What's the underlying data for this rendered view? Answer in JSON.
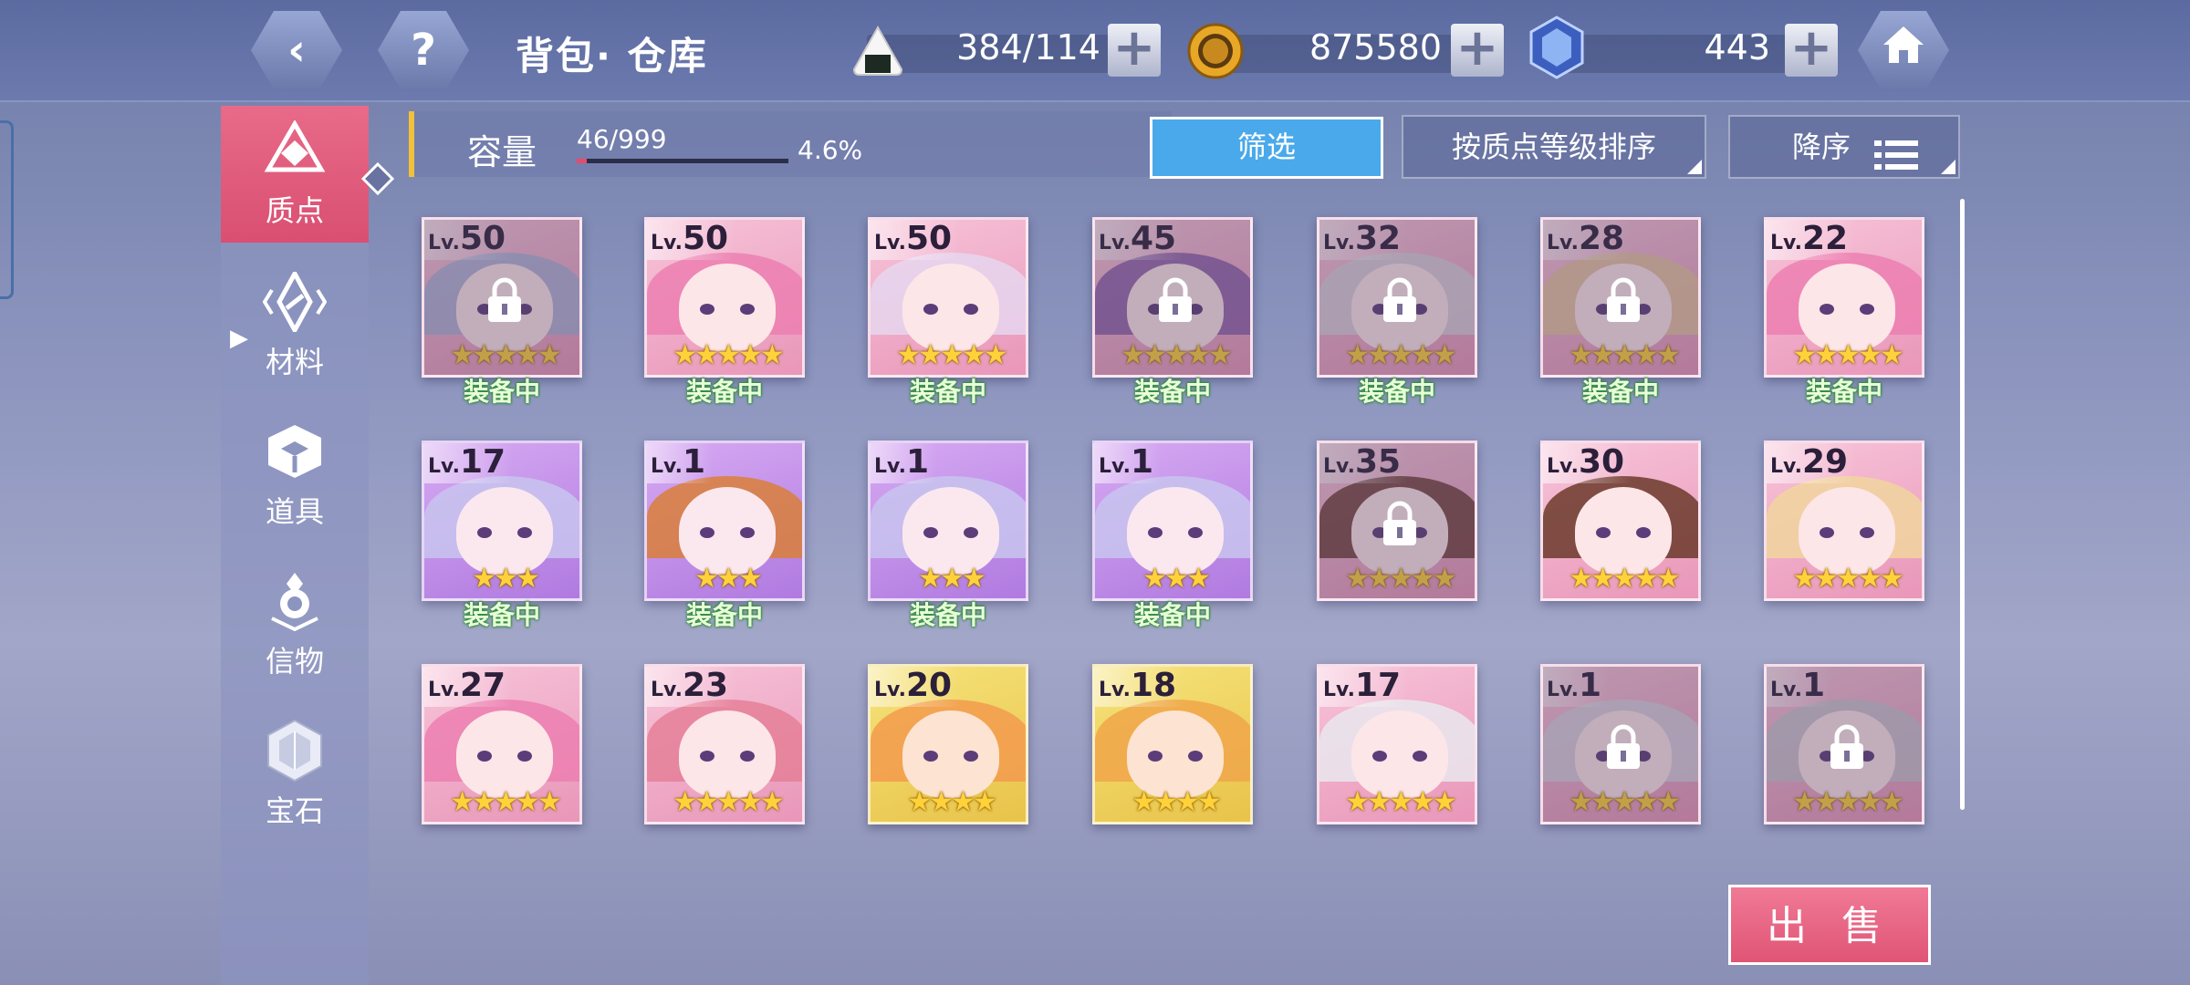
{
  "header": {
    "title": "背包· 仓库",
    "back_icon": "‹",
    "help_icon": "?",
    "stamina": "384/114",
    "gold": "875580",
    "crystal": "443"
  },
  "sidebar": {
    "items": [
      {
        "label": "质点",
        "active": true
      },
      {
        "label": "材料",
        "active": false
      },
      {
        "label": "道具",
        "active": false
      },
      {
        "label": "信物",
        "active": false
      },
      {
        "label": "宝石",
        "active": false
      }
    ]
  },
  "capacity": {
    "label": "容量",
    "count": "46/999",
    "percent": "4.6%",
    "fill_fraction": 0.046
  },
  "toolbar": {
    "filter": "筛选",
    "sort": "按质点等级排序",
    "order": "降序"
  },
  "cards": [
    {
      "lv": "50",
      "stars": 5,
      "locked": true,
      "equipped": true,
      "theme": "pink"
    },
    {
      "lv": "50",
      "stars": 5,
      "locked": false,
      "equipped": true,
      "theme": "pink"
    },
    {
      "lv": "50",
      "stars": 5,
      "locked": false,
      "equipped": true,
      "theme": "pink"
    },
    {
      "lv": "45",
      "stars": 5,
      "locked": true,
      "equipped": true,
      "theme": "pink"
    },
    {
      "lv": "32",
      "stars": 5,
      "locked": true,
      "equipped": true,
      "theme": "pink"
    },
    {
      "lv": "28",
      "stars": 5,
      "locked": true,
      "equipped": true,
      "theme": "pink"
    },
    {
      "lv": "22",
      "stars": 5,
      "locked": false,
      "equipped": true,
      "theme": "pink"
    },
    {
      "lv": "17",
      "stars": 3,
      "locked": false,
      "equipped": true,
      "theme": "purple"
    },
    {
      "lv": "1",
      "stars": 3,
      "locked": false,
      "equipped": true,
      "theme": "purple"
    },
    {
      "lv": "1",
      "stars": 3,
      "locked": false,
      "equipped": true,
      "theme": "purple"
    },
    {
      "lv": "1",
      "stars": 3,
      "locked": false,
      "equipped": true,
      "theme": "purple"
    },
    {
      "lv": "35",
      "stars": 5,
      "locked": true,
      "equipped": false,
      "theme": "pink"
    },
    {
      "lv": "30",
      "stars": 5,
      "locked": false,
      "equipped": false,
      "theme": "pink"
    },
    {
      "lv": "29",
      "stars": 5,
      "locked": false,
      "equipped": false,
      "theme": "pink"
    },
    {
      "lv": "27",
      "stars": 5,
      "locked": false,
      "equipped": false,
      "theme": "pink"
    },
    {
      "lv": "23",
      "stars": 5,
      "locked": false,
      "equipped": false,
      "theme": "pink"
    },
    {
      "lv": "20",
      "stars": 4,
      "locked": false,
      "equipped": false,
      "theme": "gold"
    },
    {
      "lv": "18",
      "stars": 4,
      "locked": false,
      "equipped": false,
      "theme": "gold"
    },
    {
      "lv": "17",
      "stars": 5,
      "locked": false,
      "equipped": false,
      "theme": "pink"
    },
    {
      "lv": "1",
      "stars": 5,
      "locked": true,
      "equipped": false,
      "theme": "pink"
    },
    {
      "lv": "1",
      "stars": 5,
      "locked": true,
      "equipped": false,
      "theme": "pink"
    }
  ],
  "card_labels": {
    "lv_prefix": "Lv.",
    "equipped": "装备中"
  },
  "sell": "出 售",
  "colors": {
    "accent_pink": "#e05475",
    "filter_blue": "#4aa9ea",
    "star_gold": "#ffd23a",
    "theme_pink": "#f4b6d0",
    "theme_purple": "#c28ce8",
    "theme_gold": "#f2d86a"
  }
}
